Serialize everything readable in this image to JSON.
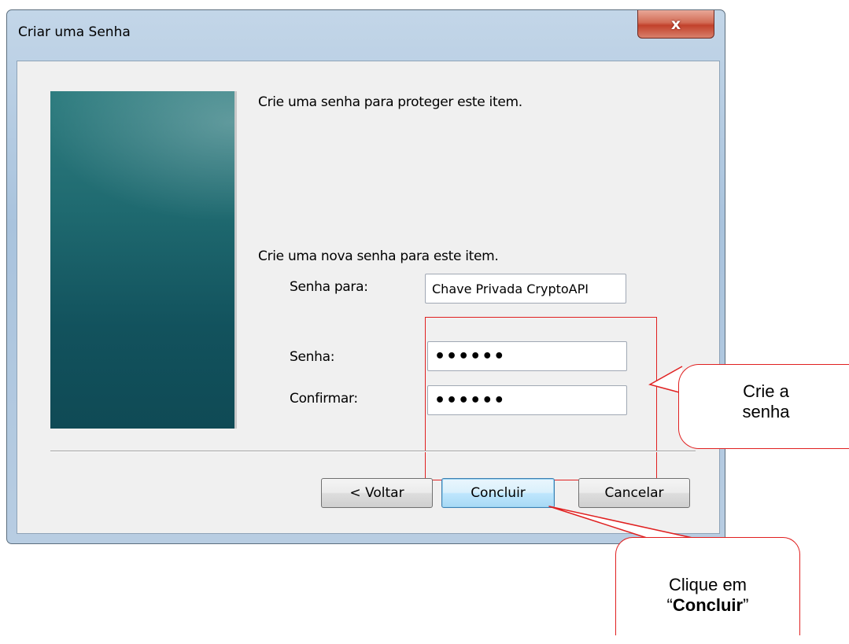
{
  "window": {
    "title": "Criar uma Senha",
    "close_label": "x"
  },
  "content": {
    "heading": "Crie uma senha para proteger este item.",
    "instruction": "Crie uma nova senha para este item.",
    "password_for_label": "Senha para:",
    "password_for_value": "Chave Privada CryptoAPI",
    "password_label": "Senha:",
    "password_mask": "••••••",
    "confirm_label": "Confirmar:",
    "confirm_mask": "••••••"
  },
  "buttons": {
    "back": "< Voltar",
    "finish": "Concluir",
    "cancel": "Cancelar"
  },
  "callouts": {
    "password_line1": "Crie a",
    "password_line2": "senha",
    "finish_line1": "Clique em",
    "finish_open_quote": "“",
    "finish_bold": "Concluir",
    "finish_close_quote": "”"
  },
  "colors": {
    "annotation": "#e02020",
    "banner": "#1f6a70"
  }
}
